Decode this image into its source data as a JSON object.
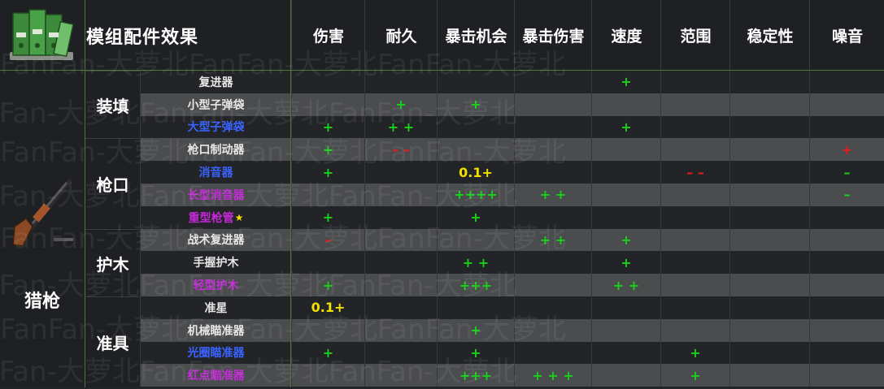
{
  "title": "模组配件效果",
  "weapon": "猎枪",
  "columns": [
    "伤害",
    "耐久",
    "暴击机会",
    "暴击伤害",
    "速度",
    "范围",
    "稳定性",
    "噪音"
  ],
  "categories": [
    {
      "label": "装填",
      "rows": 3
    },
    {
      "label": "枪口",
      "rows": 4
    },
    {
      "label": "护木",
      "rows": 3
    },
    {
      "label": "准具",
      "rows": 4
    }
  ],
  "rows": [
    {
      "name": "复进器",
      "color": "white",
      "star": "",
      "cells": [
        "",
        "",
        "",
        "",
        "+",
        "",
        "",
        ""
      ]
    },
    {
      "name": "小型子弹袋",
      "color": "white",
      "star": "",
      "cells": [
        "",
        "+",
        "+",
        "",
        "",
        "",
        "",
        ""
      ]
    },
    {
      "name": "大型子弹袋",
      "color": "blue",
      "star": "",
      "cells": [
        "+",
        "+ +",
        "",
        "",
        "+",
        "",
        "",
        ""
      ]
    },
    {
      "name": "枪口制动器",
      "color": "white",
      "star": "",
      "cells": [
        "+",
        "– –",
        "",
        "",
        "",
        "",
        "",
        "+"
      ]
    },
    {
      "name": "消音器",
      "color": "blue",
      "star": "",
      "cells": [
        "+",
        "",
        "0.1+",
        "",
        "",
        "– –",
        "",
        "–"
      ]
    },
    {
      "name": "长型消音器",
      "color": "purple",
      "star": "",
      "cells": [
        "",
        "",
        "++++",
        "+ +",
        "",
        "",
        "",
        "–"
      ]
    },
    {
      "name": "重型枪管",
      "color": "purple",
      "star": "★",
      "cells": [
        "+",
        "",
        "+",
        "",
        "",
        "",
        "",
        ""
      ]
    },
    {
      "name": "战术复进器",
      "color": "white",
      "star": "",
      "cells": [
        "–",
        "",
        "",
        "+ +",
        "+",
        "",
        "",
        ""
      ]
    },
    {
      "name": "手握护木",
      "color": "white",
      "star": "",
      "cells": [
        "",
        "",
        "+ +",
        "",
        "+",
        "",
        "",
        ""
      ]
    },
    {
      "name": "轻型护木",
      "color": "purple",
      "star": "",
      "cells": [
        "+",
        "",
        "+++",
        "",
        "+ +",
        "",
        "",
        ""
      ]
    },
    {
      "name": "准星",
      "color": "white",
      "star": "",
      "cells": [
        "0.1+",
        "",
        "",
        "",
        "",
        "",
        "",
        ""
      ]
    },
    {
      "name": "机械瞄准器",
      "color": "white",
      "star": "",
      "cells": [
        "",
        "",
        "+",
        "",
        "",
        "",
        "",
        ""
      ]
    },
    {
      "name": "光圈瞄准器",
      "color": "blue",
      "star": "",
      "cells": [
        "+",
        "",
        "+",
        "",
        "",
        "+",
        "",
        ""
      ]
    },
    {
      "name": "红点瞄准器",
      "color": "purple",
      "star": "",
      "cells": [
        "",
        "",
        "+++",
        "+ + +",
        "",
        "+",
        "",
        ""
      ]
    }
  ],
  "cell_colors": {
    "3-1": "red",
    "3-7": "red",
    "4-5": "red",
    "7-0": "red",
    "4-2": "yellow",
    "10-0": "yellow"
  },
  "watermark": "FanFan-大萝北",
  "icons": [
    "folders-icon",
    "shotgun-icon"
  ]
}
